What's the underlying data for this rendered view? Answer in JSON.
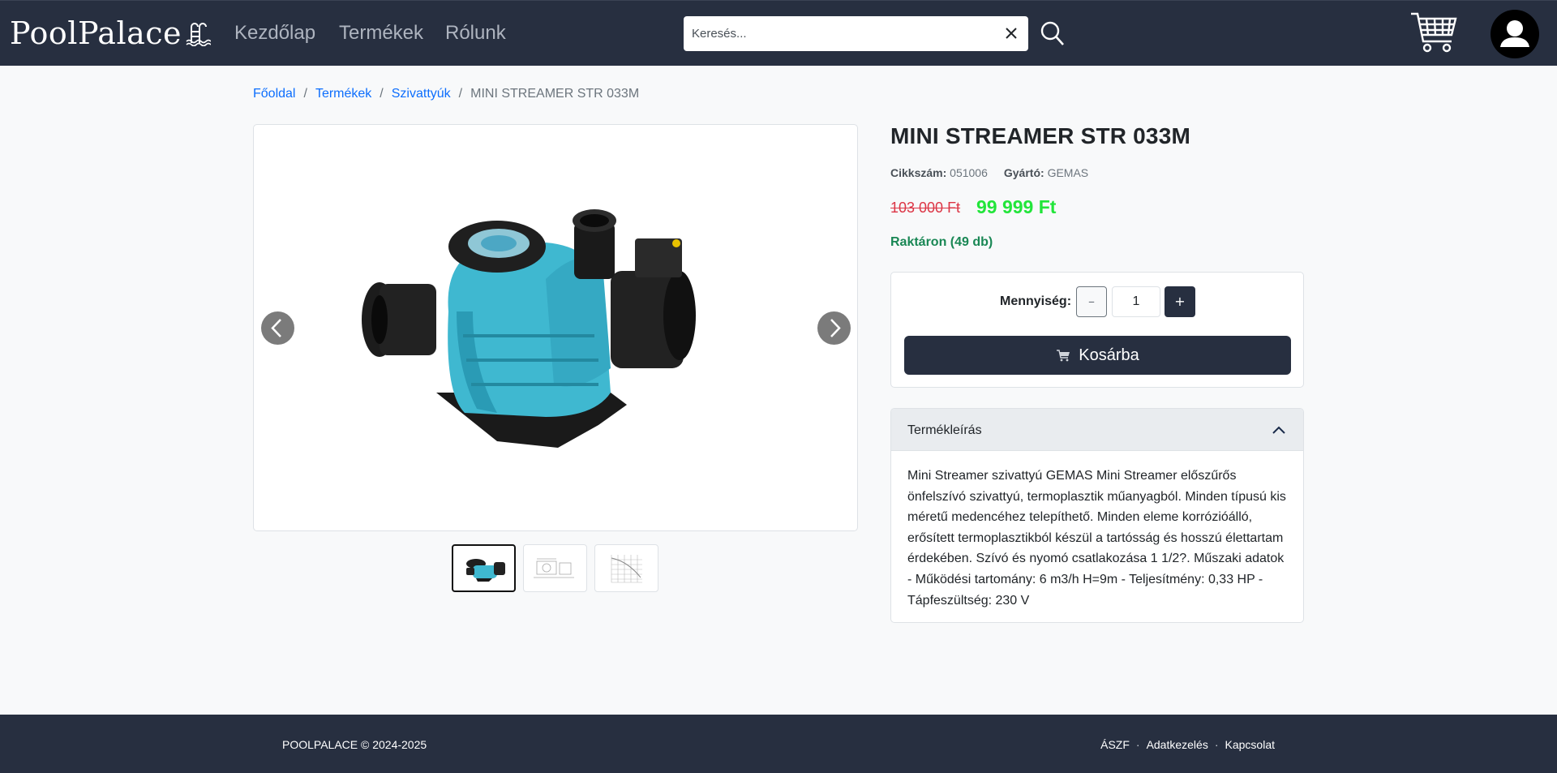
{
  "navbar": {
    "brand": "PoolPalace",
    "links": [
      "Kezdőlap",
      "Termékek",
      "Rólunk"
    ],
    "search_placeholder": "Keresés...",
    "bg_color": "#272f40"
  },
  "breadcrumb": {
    "items": [
      "Főoldal",
      "Termékek",
      "Szivattyúk"
    ],
    "current": "MINI STREAMER STR 033M"
  },
  "product": {
    "title": "MINI STREAMER STR 033M",
    "sku_label": "Cikkszám:",
    "sku": "051006",
    "maker_label": "Gyártó:",
    "maker": "GEMAS",
    "old_price": "103 000 Ft",
    "price": "99 999 Ft",
    "stock": "Raktáron (49 db)",
    "quantity_label": "Mennyiség:",
    "quantity": "1",
    "minus": "–",
    "plus": "+",
    "add_to_cart": "Kosárba",
    "description_title": "Termékleírás",
    "description": "Mini Streamer szivattyú GEMAS Mini Streamer előszűrős önfelszívó szivattyú, termoplasztik műanyagból. Minden típusú kis méretű medencéhez telepíthető. Minden eleme korrózióálló, erősített termoplasztikból készül a tartósság és hosszú élettartam érdekében. Szívó és nyomó csatlakozása 1 1/2?. Műszaki adatok - Működési tartomány: 6 m3/h H=9m - Teljesítmény: 0,33 HP - Tápfeszültség: 230 V"
  },
  "gallery": {
    "thumbnails": [
      "pump-photo",
      "dimension-drawing",
      "performance-curve"
    ],
    "active_index": 0
  },
  "footer": {
    "copyright": "POOLPALACE © 2024-2025",
    "links": [
      "ÁSZF",
      "Adatkezelés",
      "Kapcsolat"
    ]
  },
  "colors": {
    "accent": "#0d6efd",
    "old_price": "#dc3545",
    "new_price": "#22e53a",
    "stock": "#198754"
  }
}
